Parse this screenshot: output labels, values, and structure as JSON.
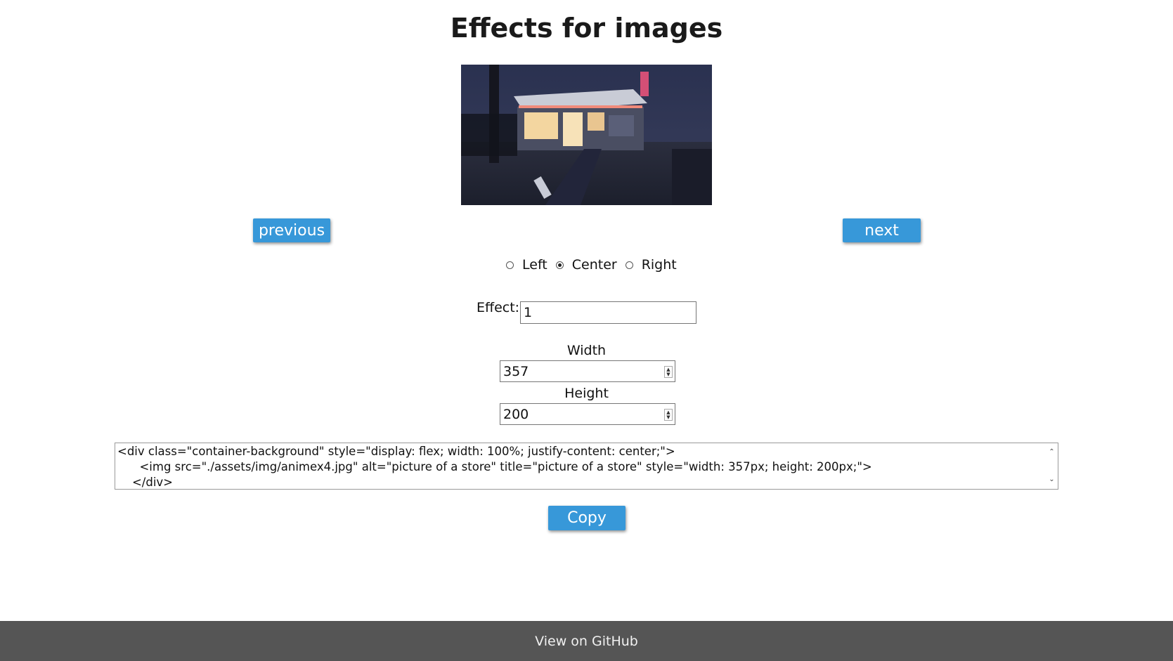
{
  "page": {
    "title": "Effects for images"
  },
  "image": {
    "alt": "picture of a store",
    "title": "picture of a store"
  },
  "nav": {
    "previous_label": "previous",
    "next_label": "next"
  },
  "alignment": {
    "options": [
      {
        "label": "Left",
        "checked": false
      },
      {
        "label": "Center",
        "checked": true
      },
      {
        "label": "Right",
        "checked": false
      }
    ]
  },
  "effect": {
    "label": "Effect:",
    "value": "1"
  },
  "dimensions": {
    "width_label": "Width",
    "width_value": "357",
    "height_label": "Height",
    "height_value": "200"
  },
  "code": {
    "line1": "<div class=\"container-background\" style=\"display: flex; width: 100%; justify-content: center;\">",
    "line2": "      <img src=\"./assets/img/animex4.jpg\" alt=\"picture of a store\" title=\"picture of a store\" style=\"width: 357px; height: 200px;\">",
    "line3": "    </div>"
  },
  "copy_label": "Copy",
  "footer": {
    "link_label": "View on GitHub"
  },
  "colors": {
    "accent": "#3798d9",
    "footer_bg": "#555555"
  }
}
